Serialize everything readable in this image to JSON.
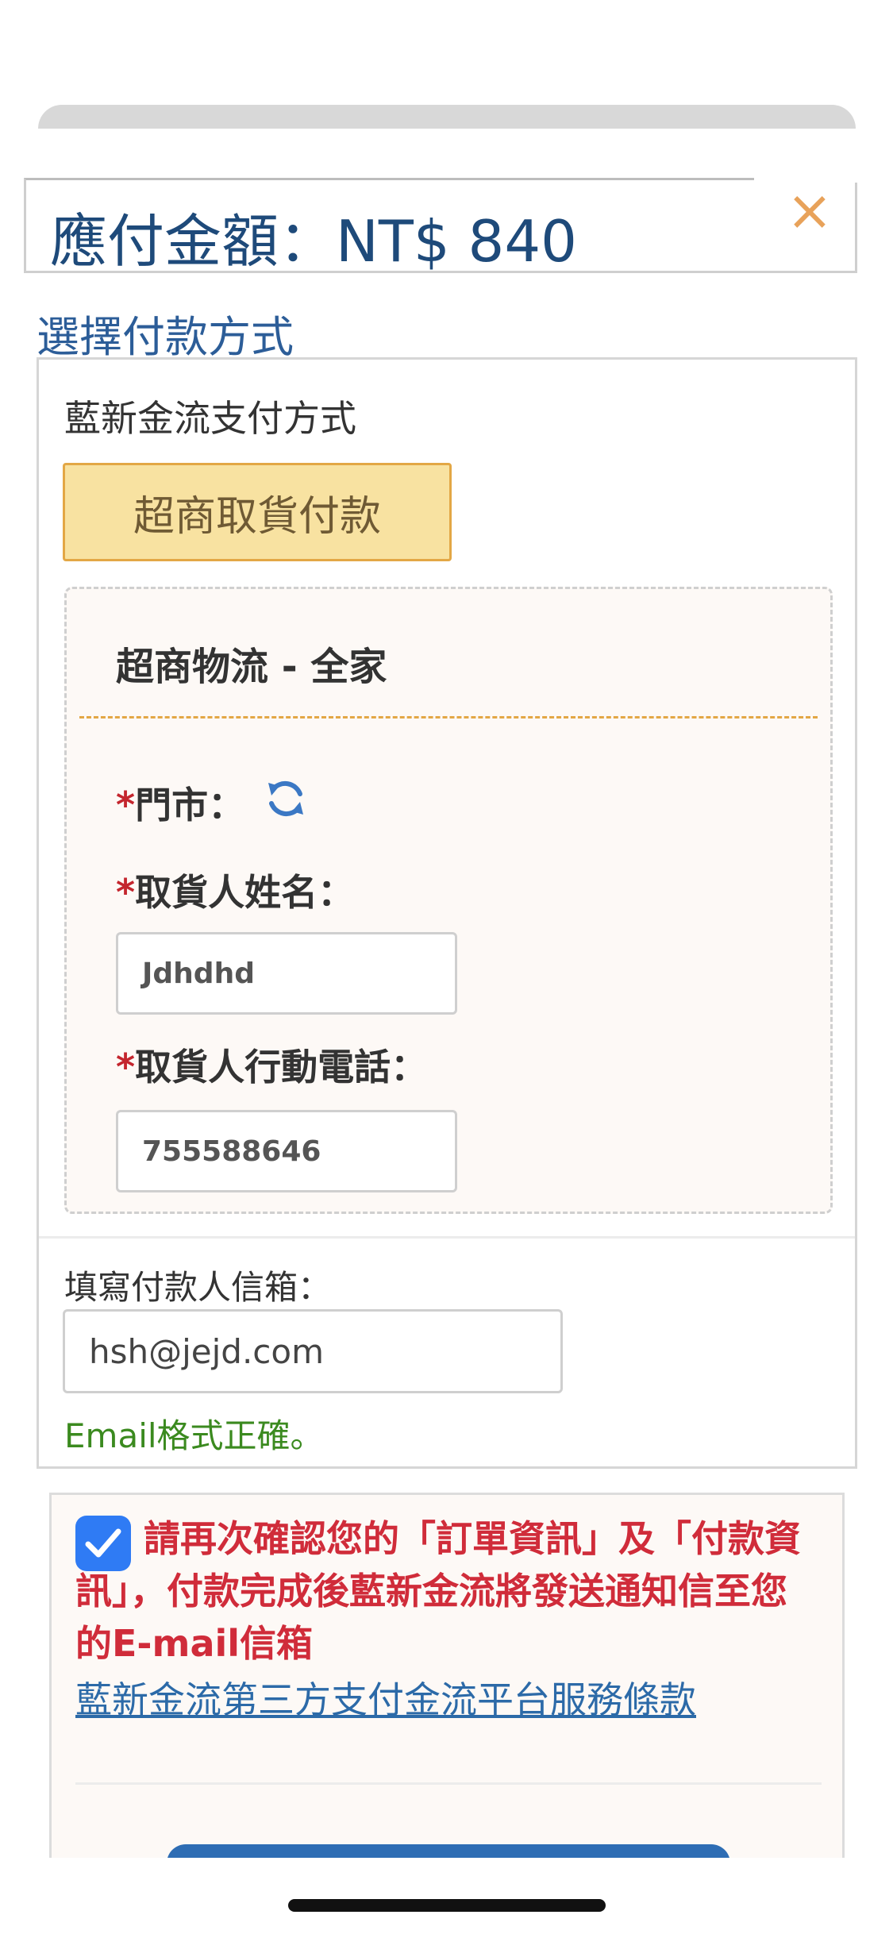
{
  "header": {
    "amount_title": "應付金額：NT$ 840",
    "close_label": "×"
  },
  "payment": {
    "section_title": "選擇付款方式",
    "provider_label": "藍新金流支付方式",
    "selected_method": "超商取貨付款"
  },
  "logistics": {
    "title": "超商物流 - 全家",
    "store_label": "門市：",
    "name_label": "取貨人姓名：",
    "name_value": "Jdhdhd",
    "phone_label": "取貨人行動電話：",
    "phone_value": "755588646",
    "required_mark": "*"
  },
  "email": {
    "label": "填寫付款人信箱：",
    "value": "hsh@jejd.com",
    "validation": "Email格式正確。"
  },
  "confirm": {
    "checked": true,
    "text": "請再次確認您的「訂單資訊」及「付款資訊」，付款完成後藍新金流將發送通知信至您的E-mail信箱",
    "terms_link": "藍新金流第三方支付金流平台服務條款"
  },
  "colors": {
    "amount_text": "#1e4a7a",
    "accent_orange": "#e8a25a",
    "selected_method_bg": "#f8e2a1",
    "required_red": "#c4262e",
    "success_green": "#3b8a1f",
    "warning_red": "#d02c3a",
    "link_blue": "#2c6aa8",
    "checkbox_blue": "#2f7bf4"
  }
}
